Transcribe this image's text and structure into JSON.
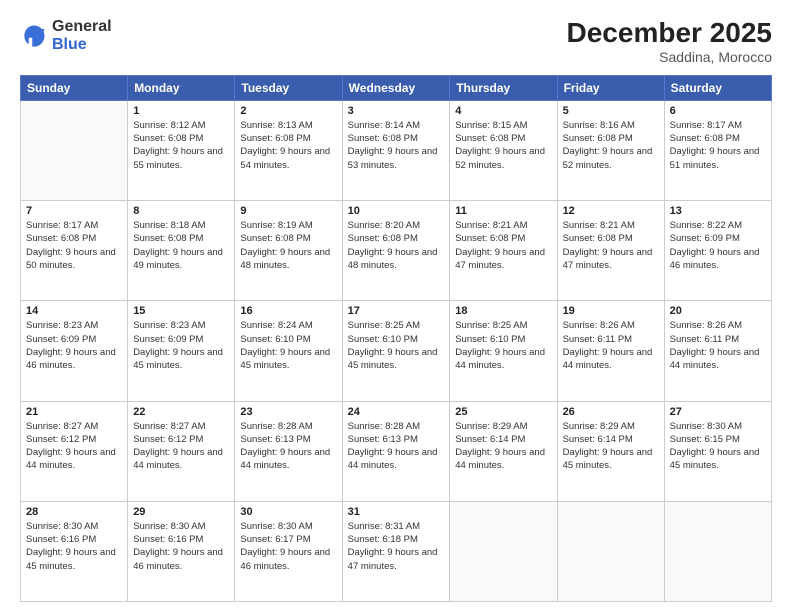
{
  "logo": {
    "general": "General",
    "blue": "Blue"
  },
  "header": {
    "month_year": "December 2025",
    "location": "Saddina, Morocco"
  },
  "weekdays": [
    "Sunday",
    "Monday",
    "Tuesday",
    "Wednesday",
    "Thursday",
    "Friday",
    "Saturday"
  ],
  "weeks": [
    [
      {
        "day": "",
        "sunrise": "",
        "sunset": "",
        "daylight": ""
      },
      {
        "day": "1",
        "sunrise": "Sunrise: 8:12 AM",
        "sunset": "Sunset: 6:08 PM",
        "daylight": "Daylight: 9 hours and 55 minutes."
      },
      {
        "day": "2",
        "sunrise": "Sunrise: 8:13 AM",
        "sunset": "Sunset: 6:08 PM",
        "daylight": "Daylight: 9 hours and 54 minutes."
      },
      {
        "day": "3",
        "sunrise": "Sunrise: 8:14 AM",
        "sunset": "Sunset: 6:08 PM",
        "daylight": "Daylight: 9 hours and 53 minutes."
      },
      {
        "day": "4",
        "sunrise": "Sunrise: 8:15 AM",
        "sunset": "Sunset: 6:08 PM",
        "daylight": "Daylight: 9 hours and 52 minutes."
      },
      {
        "day": "5",
        "sunrise": "Sunrise: 8:16 AM",
        "sunset": "Sunset: 6:08 PM",
        "daylight": "Daylight: 9 hours and 52 minutes."
      },
      {
        "day": "6",
        "sunrise": "Sunrise: 8:17 AM",
        "sunset": "Sunset: 6:08 PM",
        "daylight": "Daylight: 9 hours and 51 minutes."
      }
    ],
    [
      {
        "day": "7",
        "sunrise": "Sunrise: 8:17 AM",
        "sunset": "Sunset: 6:08 PM",
        "daylight": "Daylight: 9 hours and 50 minutes."
      },
      {
        "day": "8",
        "sunrise": "Sunrise: 8:18 AM",
        "sunset": "Sunset: 6:08 PM",
        "daylight": "Daylight: 9 hours and 49 minutes."
      },
      {
        "day": "9",
        "sunrise": "Sunrise: 8:19 AM",
        "sunset": "Sunset: 6:08 PM",
        "daylight": "Daylight: 9 hours and 48 minutes."
      },
      {
        "day": "10",
        "sunrise": "Sunrise: 8:20 AM",
        "sunset": "Sunset: 6:08 PM",
        "daylight": "Daylight: 9 hours and 48 minutes."
      },
      {
        "day": "11",
        "sunrise": "Sunrise: 8:21 AM",
        "sunset": "Sunset: 6:08 PM",
        "daylight": "Daylight: 9 hours and 47 minutes."
      },
      {
        "day": "12",
        "sunrise": "Sunrise: 8:21 AM",
        "sunset": "Sunset: 6:08 PM",
        "daylight": "Daylight: 9 hours and 47 minutes."
      },
      {
        "day": "13",
        "sunrise": "Sunrise: 8:22 AM",
        "sunset": "Sunset: 6:09 PM",
        "daylight": "Daylight: 9 hours and 46 minutes."
      }
    ],
    [
      {
        "day": "14",
        "sunrise": "Sunrise: 8:23 AM",
        "sunset": "Sunset: 6:09 PM",
        "daylight": "Daylight: 9 hours and 46 minutes."
      },
      {
        "day": "15",
        "sunrise": "Sunrise: 8:23 AM",
        "sunset": "Sunset: 6:09 PM",
        "daylight": "Daylight: 9 hours and 45 minutes."
      },
      {
        "day": "16",
        "sunrise": "Sunrise: 8:24 AM",
        "sunset": "Sunset: 6:10 PM",
        "daylight": "Daylight: 9 hours and 45 minutes."
      },
      {
        "day": "17",
        "sunrise": "Sunrise: 8:25 AM",
        "sunset": "Sunset: 6:10 PM",
        "daylight": "Daylight: 9 hours and 45 minutes."
      },
      {
        "day": "18",
        "sunrise": "Sunrise: 8:25 AM",
        "sunset": "Sunset: 6:10 PM",
        "daylight": "Daylight: 9 hours and 44 minutes."
      },
      {
        "day": "19",
        "sunrise": "Sunrise: 8:26 AM",
        "sunset": "Sunset: 6:11 PM",
        "daylight": "Daylight: 9 hours and 44 minutes."
      },
      {
        "day": "20",
        "sunrise": "Sunrise: 8:26 AM",
        "sunset": "Sunset: 6:11 PM",
        "daylight": "Daylight: 9 hours and 44 minutes."
      }
    ],
    [
      {
        "day": "21",
        "sunrise": "Sunrise: 8:27 AM",
        "sunset": "Sunset: 6:12 PM",
        "daylight": "Daylight: 9 hours and 44 minutes."
      },
      {
        "day": "22",
        "sunrise": "Sunrise: 8:27 AM",
        "sunset": "Sunset: 6:12 PM",
        "daylight": "Daylight: 9 hours and 44 minutes."
      },
      {
        "day": "23",
        "sunrise": "Sunrise: 8:28 AM",
        "sunset": "Sunset: 6:13 PM",
        "daylight": "Daylight: 9 hours and 44 minutes."
      },
      {
        "day": "24",
        "sunrise": "Sunrise: 8:28 AM",
        "sunset": "Sunset: 6:13 PM",
        "daylight": "Daylight: 9 hours and 44 minutes."
      },
      {
        "day": "25",
        "sunrise": "Sunrise: 8:29 AM",
        "sunset": "Sunset: 6:14 PM",
        "daylight": "Daylight: 9 hours and 44 minutes."
      },
      {
        "day": "26",
        "sunrise": "Sunrise: 8:29 AM",
        "sunset": "Sunset: 6:14 PM",
        "daylight": "Daylight: 9 hours and 45 minutes."
      },
      {
        "day": "27",
        "sunrise": "Sunrise: 8:30 AM",
        "sunset": "Sunset: 6:15 PM",
        "daylight": "Daylight: 9 hours and 45 minutes."
      }
    ],
    [
      {
        "day": "28",
        "sunrise": "Sunrise: 8:30 AM",
        "sunset": "Sunset: 6:16 PM",
        "daylight": "Daylight: 9 hours and 45 minutes."
      },
      {
        "day": "29",
        "sunrise": "Sunrise: 8:30 AM",
        "sunset": "Sunset: 6:16 PM",
        "daylight": "Daylight: 9 hours and 46 minutes."
      },
      {
        "day": "30",
        "sunrise": "Sunrise: 8:30 AM",
        "sunset": "Sunset: 6:17 PM",
        "daylight": "Daylight: 9 hours and 46 minutes."
      },
      {
        "day": "31",
        "sunrise": "Sunrise: 8:31 AM",
        "sunset": "Sunset: 6:18 PM",
        "daylight": "Daylight: 9 hours and 47 minutes."
      },
      {
        "day": "",
        "sunrise": "",
        "sunset": "",
        "daylight": ""
      },
      {
        "day": "",
        "sunrise": "",
        "sunset": "",
        "daylight": ""
      },
      {
        "day": "",
        "sunrise": "",
        "sunset": "",
        "daylight": ""
      }
    ]
  ]
}
